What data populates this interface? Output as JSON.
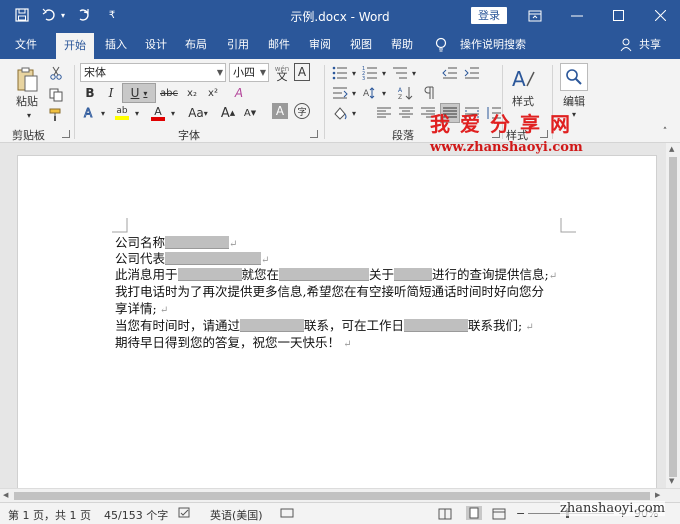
{
  "title_bar": {
    "doc_title": "示例.docx - Word",
    "login_label": "登录",
    "icons": [
      "save-icon",
      "undo-icon",
      "redo-icon",
      "customize-icon"
    ]
  },
  "tabs": [
    {
      "label": "文件"
    },
    {
      "label": "开始"
    },
    {
      "label": "插入"
    },
    {
      "label": "设计"
    },
    {
      "label": "布局"
    },
    {
      "label": "引用"
    },
    {
      "label": "邮件"
    },
    {
      "label": "审阅"
    },
    {
      "label": "视图"
    },
    {
      "label": "帮助"
    }
  ],
  "tell_me": "操作说明搜索",
  "share": "共享",
  "ribbon": {
    "clipboard": {
      "paste_label": "粘贴",
      "group_label": "剪贴板"
    },
    "font": {
      "font_name": "宋体",
      "font_size": "小四",
      "wen_label": "wén",
      "char_border_label": "A",
      "bold": "B",
      "italic": "I",
      "underline": "U",
      "strike": "abc",
      "subscript": "x₂",
      "superscript": "x²",
      "clear_format": "A",
      "highlight_label": "ab",
      "font_color_label": "A",
      "change_case": "Aa",
      "grow": "A",
      "shrink": "A",
      "char_shading": "A",
      "enclose": "字",
      "group_label": "字体"
    },
    "paragraph": {
      "group_label": "段落"
    },
    "styles": {
      "styles_label": "样式",
      "group_label": "样式"
    },
    "editing": {
      "editing_label": "编辑"
    }
  },
  "document": {
    "lines": [
      {
        "parts": [
          {
            "t": "公司名称"
          },
          {
            "r": 64
          },
          {
            "p": "↵"
          }
        ]
      },
      {
        "parts": [
          {
            "t": "公司代表"
          },
          {
            "r": 96
          },
          {
            "p": "↵"
          }
        ]
      },
      {
        "parts": [
          {
            "t": "此消息用于"
          },
          {
            "r": 64
          },
          {
            "t": "就您在"
          },
          {
            "r": 90
          },
          {
            "t": "关于"
          },
          {
            "r": 38
          },
          {
            "t": "进行的查询提供信息;"
          },
          {
            "p": "↵"
          }
        ]
      },
      {
        "parts": [
          {
            "t": "我打电话时为了再次提供更多信息,希望您在有空接听简短通话时间时好向您分"
          }
        ]
      },
      {
        "parts": [
          {
            "t": "享详情;"
          },
          {
            "p": " ↵"
          }
        ]
      },
      {
        "parts": [
          {
            "t": "当您有时间时，请通过"
          },
          {
            "r": 64
          },
          {
            "t": "联系，可在工作日"
          },
          {
            "r": 64
          },
          {
            "t": "联系我们;"
          },
          {
            "p": " ↵"
          }
        ]
      },
      {
        "parts": [
          {
            "t": "期待早日得到您的答复，祝您一天快乐！"
          },
          {
            "p": " ↵"
          }
        ]
      }
    ]
  },
  "status_bar": {
    "page": "第 1 页，共 1 页",
    "words": "45/153 个字",
    "language": "英语(美国)",
    "zoom": "90%"
  },
  "watermark": {
    "cn": "我爱分享网",
    "url": "www.zhanshaoyi.com",
    "url2": "zhanshaoyi.com"
  }
}
